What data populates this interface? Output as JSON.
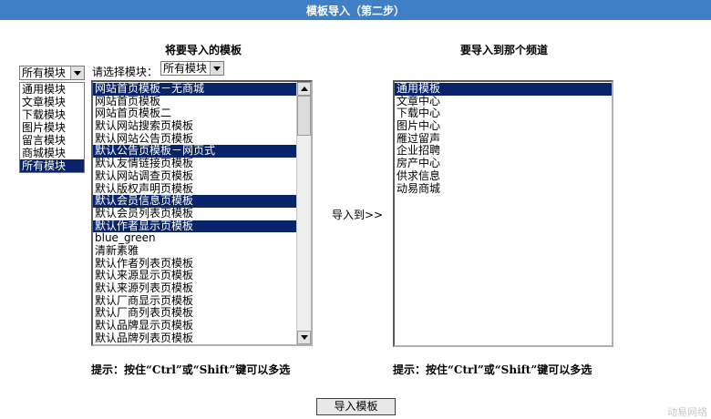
{
  "title": "模板导入（第二步）",
  "left_panel": {
    "heading": "将要导入的模板",
    "filter_label": "请选择模块：",
    "filter_value": "所有模块",
    "outer_filter_value": "所有模块",
    "dropdown_options": [
      {
        "label": "通用模块",
        "selected": false
      },
      {
        "label": "文章模块",
        "selected": false
      },
      {
        "label": "下载模块",
        "selected": false
      },
      {
        "label": "图片模块",
        "selected": false
      },
      {
        "label": "留言模块",
        "selected": false
      },
      {
        "label": "商城模块",
        "selected": false
      },
      {
        "label": "所有模块",
        "selected": true
      }
    ],
    "templates": [
      {
        "label": "网站首页模板－无商城",
        "selected": true
      },
      {
        "label": "网站首页模板",
        "selected": false
      },
      {
        "label": "网站首页模板二",
        "selected": false
      },
      {
        "label": "默认网站搜索页模板",
        "selected": false
      },
      {
        "label": "默认网站公告页模板",
        "selected": false
      },
      {
        "label": "默认公告页模板－网页式",
        "selected": true
      },
      {
        "label": "默认友情链接页模板",
        "selected": false
      },
      {
        "label": "默认网站调查页模板",
        "selected": false
      },
      {
        "label": "默认版权声明页模板",
        "selected": false
      },
      {
        "label": "默认会员信息页模板",
        "selected": true
      },
      {
        "label": "默认会员列表页模板",
        "selected": false
      },
      {
        "label": "默认作者显示页模板",
        "selected": true
      },
      {
        "label": "blue_green",
        "selected": false
      },
      {
        "label": "清新素雅",
        "selected": false
      },
      {
        "label": "默认作者列表页模板",
        "selected": false
      },
      {
        "label": "默认来源显示页模板",
        "selected": false
      },
      {
        "label": "默认来源列表页模板",
        "selected": false
      },
      {
        "label": "默认厂商显示页模板",
        "selected": false
      },
      {
        "label": "默认厂商列表页模板",
        "selected": false
      },
      {
        "label": "默认品牌显示页模板",
        "selected": false
      },
      {
        "label": "默认品牌列表页模板",
        "selected": false
      }
    ],
    "tip": "提示：按住“Ctrl”或“Shift”键可以多选"
  },
  "import_to_label": "导入到>>",
  "right_panel": {
    "heading": "要导入到那个频道",
    "channels": [
      {
        "label": "通用模板",
        "selected": true
      },
      {
        "label": "文章中心",
        "selected": false
      },
      {
        "label": "下载中心",
        "selected": false
      },
      {
        "label": "图片中心",
        "selected": false
      },
      {
        "label": "雁过留声",
        "selected": false
      },
      {
        "label": "企业招聘",
        "selected": false
      },
      {
        "label": "房产中心",
        "selected": false
      },
      {
        "label": "供求信息",
        "selected": false
      },
      {
        "label": "动易商城",
        "selected": false
      }
    ],
    "tip": "提示：按住“Ctrl”或“Shift”键可以多选"
  },
  "submit_label": "导入模板",
  "brand": "动易网络",
  "colors": {
    "titlebar": "#3f7fc6",
    "selection": "#0a246a"
  }
}
